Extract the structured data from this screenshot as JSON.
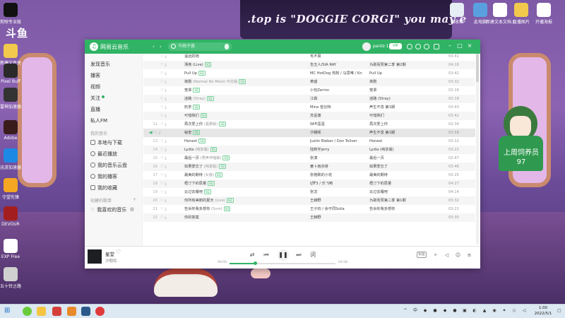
{
  "desktop": {
    "banner_text": ".top is \"DOGGIE CORGI\"  you may e",
    "logo": "斗鱼",
    "icons_left": [
      {
        "label": "剪映专业版",
        "icon": "scissors-icon",
        "color": "#111111"
      },
      {
        "label": "新建文件夹",
        "icon": "folder-icon",
        "color": "#f2c94c"
      },
      {
        "label": "Pixel Buff",
        "icon": "app-icon",
        "color": "#2a2a2a"
      },
      {
        "label": "雷神加速器",
        "icon": "app-icon",
        "color": "#333333"
      },
      {
        "label": "Adobe",
        "icon": "app-icon",
        "color": "#3a1c1c"
      },
      {
        "label": "迅游加速器",
        "icon": "app-icon",
        "color": "#1e88e5"
      },
      {
        "label": "守望先锋",
        "icon": "overwatch-icon",
        "color": "#f5a623"
      },
      {
        "label": "DEVOUR",
        "icon": "app-icon",
        "color": "#a31f1f"
      },
      {
        "label": "EXP Free",
        "icon": "document-icon",
        "color": "#ffffff"
      },
      {
        "label": "五十铃之路",
        "icon": "app-icon",
        "color": "#d0d0d0"
      }
    ],
    "icons_right": [
      {
        "label": "回收站",
        "icon": "recycle-bin-icon",
        "color": "#e6eef5"
      },
      {
        "label": "此电脑",
        "icon": "computer-icon",
        "color": "#5aa0e0"
      },
      {
        "label": "新建文本文档.txt",
        "icon": "document-icon",
        "color": "#ffffff"
      },
      {
        "label": "直播图片",
        "icon": "folder-icon",
        "color": "#f2c94c"
      },
      {
        "label": "开播海报",
        "icon": "image-icon",
        "color": "#ffffff"
      }
    ],
    "streamer_label": "上周饲养员",
    "streamer_count": "97"
  },
  "app": {
    "name": "网易云音乐",
    "search_placeholder": "乌梅子酱",
    "user_name": "pants·1",
    "vip_badge": "VIP",
    "sidebar": {
      "items": [
        {
          "label": "发现音乐"
        },
        {
          "label": "播客"
        },
        {
          "label": "视频"
        },
        {
          "label": "关注"
        },
        {
          "label": "直播"
        },
        {
          "label": "私人FM"
        }
      ],
      "my_music_header": "我的音乐",
      "my_music": [
        {
          "label": "本地与下载",
          "icon": "download-icon"
        },
        {
          "label": "最近播放",
          "icon": "clock-icon"
        },
        {
          "label": "我的音乐云盘",
          "icon": "cloud-icon"
        },
        {
          "label": "我的播客",
          "icon": "podcast-icon"
        },
        {
          "label": "我的收藏",
          "icon": "star-icon"
        }
      ],
      "created_header": "创建的歌单",
      "created": [
        {
          "label": "我喜欢的音乐",
          "icon": "heart-icon"
        }
      ]
    },
    "songs": [
      {
        "num": "",
        "title": "遥远的她",
        "sub": "",
        "tag": "",
        "artist": "毛不易",
        "album": "",
        "duration": "03:41"
      },
      {
        "num": "",
        "title": "漂亮 (Live)",
        "sub": "",
        "tag": "SQ",
        "artist": "告五人/SIA RAY",
        "album": "为歌而赞第二季 第2期",
        "duration": "04:18"
      },
      {
        "num": "",
        "title": "Pull Up",
        "sub": "",
        "tag": "SQ",
        "artist": "MC HotDog 热狗 / 马思唯 / Kn",
        "album": "Pull Up",
        "duration": "03:42"
      },
      {
        "num": "",
        "title": "抹剧",
        "sub": "(Normal No More) 中文版",
        "tag": "SQ",
        "artist": "黄盛",
        "album": "抹剧",
        "duration": "03:32"
      },
      {
        "num": "",
        "title": "笼罩",
        "sub": "",
        "tag": "SQ",
        "artist": "小包Zerinn",
        "album": "笼罩",
        "duration": "03:16"
      },
      {
        "num": "",
        "title": "迷路",
        "sub": "(Stray)",
        "tag": "SQ",
        "artist": "江霖",
        "album": "迷路 (Stray)",
        "duration": "03:18"
      },
      {
        "num": "",
        "title": "奶茶",
        "sub": "",
        "tag": "SQ",
        "artist": "Mine 曾比特",
        "album": "声生不息 第1期",
        "duration": "03:43"
      },
      {
        "num": "",
        "title": "可惜我们",
        "sub": "",
        "tag": "SQ",
        "artist": "苏星捷",
        "album": "可惜我们",
        "duration": "03:42"
      },
      {
        "num": "11",
        "title": "再次爱上你",
        "sub": "(温柔版)",
        "tag": "SQ",
        "artist": "WiFi歪歪",
        "album": "再次爱上你",
        "duration": "02:34"
      },
      {
        "num": "",
        "title": "秘密",
        "sub": "",
        "tag": "SQ",
        "artist": "汐朝晖",
        "album": "声生不息 第1期",
        "duration": "03:58"
      },
      {
        "num": "13",
        "title": "Honest",
        "sub": "",
        "tag": "SQ",
        "artist": "Justin Bieber / Don Toliver",
        "album": "Honest",
        "duration": "03:12"
      },
      {
        "num": "14",
        "title": "Lydia",
        "sub": "(纯享版)",
        "tag": "SQ",
        "artist": "陆新宇jerry",
        "album": "Lydia (纯享版)",
        "duration": "03:22"
      },
      {
        "num": "15",
        "title": "最后一页",
        "sub": "(男声伴唱版)",
        "tag": "SQ",
        "artist": "张澳",
        "album": "最后一页",
        "duration": "02:47"
      },
      {
        "num": "16",
        "title": "如果爱忘了",
        "sub": "(纯享版)",
        "tag": "SQ",
        "artist": "姜卜雨宗芽",
        "album": "如果爱忘了",
        "duration": "03:46"
      },
      {
        "num": "17",
        "title": "最美的期待",
        "sub": "(女版)",
        "tag": "SQ",
        "artist": "张格致的小花",
        "album": "最美的期待",
        "duration": "03:25"
      },
      {
        "num": "18",
        "title": "梧汀下的思量",
        "sub": "",
        "tag": "SQ",
        "artist": "IJ罗3 / 乐飞鸭",
        "album": "梧汀下的思量",
        "duration": "04:27"
      },
      {
        "num": "19",
        "title": "云过去睡吧",
        "sub": "",
        "tag": "SQ",
        "artist": "张龙",
        "album": "云过去睡吧",
        "duration": "04:14"
      },
      {
        "num": "20",
        "title": "你所有美丽的夏天",
        "sub": "(Live)",
        "tag": "SQ",
        "artist": "王赫野",
        "album": "为歌而赞第二季 第1期",
        "duration": "03:32"
      },
      {
        "num": "21",
        "title": "告诉你我多想你",
        "sub": "(Sum)",
        "tag": "SQ",
        "artist": "王子钧 / 余不同Solia",
        "album": "告诉你我多想你",
        "duration": "03:21"
      },
      {
        "num": "22",
        "title": "你的答案",
        "sub": "",
        "tag": "",
        "artist": "王赫野",
        "album": "",
        "duration": "03:35"
      }
    ],
    "player": {
      "title": "星堂",
      "artist": "汐朝晖",
      "time_current": "00:00",
      "time_total": "03:58",
      "progress": 0.24,
      "quality": "标准"
    }
  },
  "taskbar": {
    "time": "1:00",
    "date": "2022/5/1",
    "ime": "中"
  },
  "colors": {
    "brand": "#31b365",
    "playing_row": "#e6e6e6"
  }
}
